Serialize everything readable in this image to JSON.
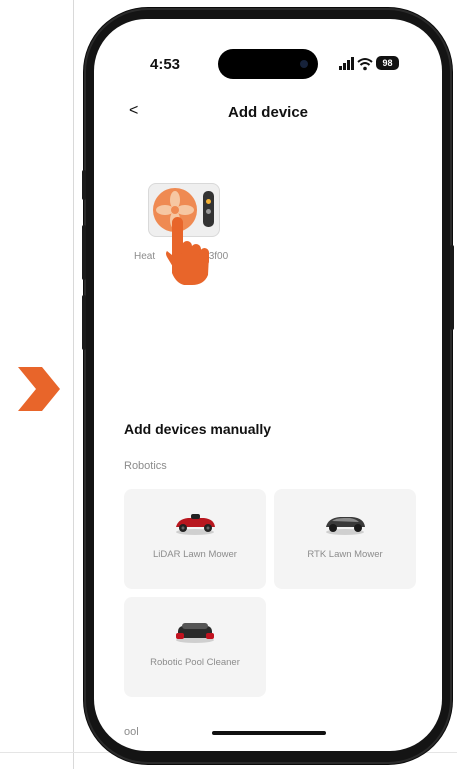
{
  "colors": {
    "accent": "#e8652a",
    "fan": "#ef8a52",
    "text_primary": "#111111",
    "text_secondary": "#8c8c8c",
    "card_bg": "#f4f4f4"
  },
  "status_bar": {
    "time": "4:53",
    "battery": "98"
  },
  "header": {
    "back_icon": "chevron-left-icon",
    "back_label": "<",
    "title": "Add device"
  },
  "discovered": {
    "label_left": "Heat",
    "label_right": "3f00",
    "icon": "heater-icon",
    "gesture_icon": "tapping-hand-icon"
  },
  "manual": {
    "title": "Add devices manually",
    "category": "Robotics",
    "devices": [
      {
        "label": "LiDAR Lawn Mower",
        "icon": "lidar-lawn-mower-icon"
      },
      {
        "label": "RTK Lawn Mower",
        "icon": "rtk-lawn-mower-icon"
      },
      {
        "label": "Robotic Pool Cleaner",
        "icon": "robotic-pool-cleaner-icon"
      }
    ],
    "next_category_partial": "ool"
  }
}
